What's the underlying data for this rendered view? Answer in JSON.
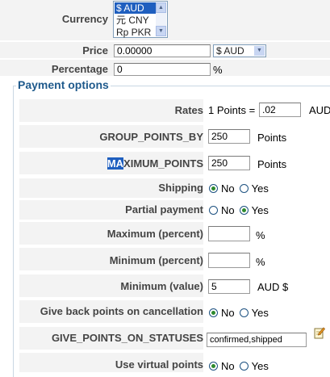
{
  "top": {
    "currency_label": "Currency",
    "currency_options": [
      "$ AUD",
      "元 CNY",
      "Rp PKR"
    ],
    "currency_selected": "$ AUD",
    "price_label": "Price",
    "price_value": "0.00000",
    "price_currency": "$ AUD",
    "percentage_label": "Percentage",
    "percentage_value": "0",
    "percentage_unit": "%"
  },
  "section": {
    "title": "Payment options"
  },
  "rows": {
    "rates": {
      "label": "Rates",
      "prefix": "1 Points =",
      "value": ".02",
      "suffix": "AUD"
    },
    "group_points_by": {
      "label": "GROUP_POINTS_BY",
      "value": "250",
      "suffix": "Points"
    },
    "maximum_points": {
      "label_highlight": "MA",
      "label_rest": "XIMUM_POINTS",
      "value": "250",
      "suffix": "Points"
    },
    "shipping": {
      "label": "Shipping",
      "no": "No",
      "yes": "Yes",
      "selected": "No"
    },
    "partial_payment": {
      "label": "Partial payment",
      "no": "No",
      "yes": "Yes",
      "selected": "Yes"
    },
    "maximum_percent": {
      "label": "Maximum (percent)",
      "value": "",
      "suffix": "%"
    },
    "minimum_percent": {
      "label": "Minimum (percent)",
      "value": "",
      "suffix": "%"
    },
    "minimum_value": {
      "label": "Minimum (value)",
      "value": "5",
      "suffix": "AUD $"
    },
    "give_back": {
      "label": "Give back points on cancellation",
      "no": "No",
      "yes": "Yes",
      "selected": "No"
    },
    "give_points_statuses": {
      "label": "GIVE_POINTS_ON_STATUSES",
      "value": "confirmed,shipped",
      "icon": "edit-note-icon"
    },
    "virtual_points": {
      "label": "Use virtual points",
      "no": "No",
      "yes": "Yes",
      "selected": "No"
    }
  },
  "colors": {
    "section_title": "#1f5a8c",
    "fieldset_border": "#c9d7e3",
    "highlight": "#1f5fbf",
    "radio_checked": "#2d8a2d"
  }
}
